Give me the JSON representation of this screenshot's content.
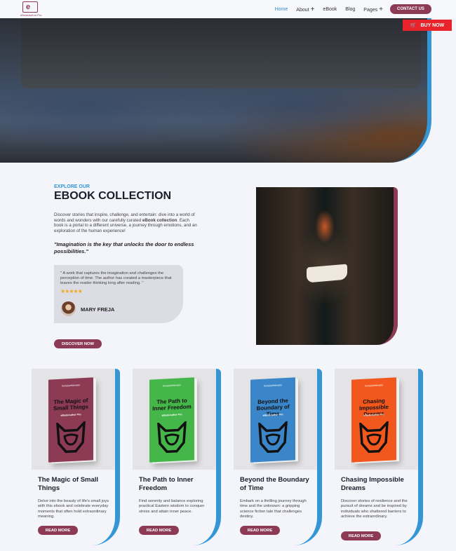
{
  "header": {
    "logo_text": "eBookAuthor Pro",
    "nav": [
      {
        "label": "Home",
        "active": true
      },
      {
        "label": "About",
        "has_submenu": true
      },
      {
        "label": "eBook"
      },
      {
        "label": "Blog"
      },
      {
        "label": "Pages",
        "has_submenu": true
      }
    ],
    "contact_label": "CONTACT US",
    "buy_label": "BUY NOW",
    "buy_icon": "cart-icon"
  },
  "collection": {
    "eyebrow": "EXPLORE OUR",
    "title": "EBOOK COLLECTION",
    "intro_before": "Discover stories that inspire, challenge, and entertain: dive into a world of words and wonders with our carefully curated ",
    "intro_bold": "eBook collection",
    "intro_after": ". Each book is a portal to a different universe, a journey through emotions, and an exploration of the human experience!",
    "quote": "\"Imagination is the key that unlocks the door to endless possibilities.\"",
    "testimonial": {
      "text": "\" A work that captures the imagination and challenges the perception of time. The author has created a masterpiece that leaves the reader thinking long after reading. \"",
      "rating": 5,
      "stars": "★★★★★",
      "name": "MARY FREJA"
    },
    "cta": "DISCOVER NOW"
  },
  "books": [
    {
      "cover_title": "The Magic of Small Things",
      "cover_sub": "eBookAuthor Pro",
      "cover_label": "TemplateMonster",
      "color": "#8d3a55",
      "title": "The Magic of Small Things",
      "desc": "Delve into the beauty of life's small joys with this ebook and celebrate everyday moments that often hold extraordinary meaning.",
      "button": "READ MORE"
    },
    {
      "cover_title": "The Path to Inner Freedom",
      "cover_sub": "eBookAuthor Pro",
      "cover_label": "TemplateMonster",
      "color": "#45b649",
      "title": "The Path to Inner Freedom",
      "desc": "Find serenity and balance exploring practical Eastern wisdom to conquer stress and attain inner peace.",
      "button": "READ MORE"
    },
    {
      "cover_title": "Beyond the Boundary of Time",
      "cover_sub": "eBookAuthor Pro",
      "cover_label": "TemplateMonster",
      "color": "#3a86c8",
      "title": "Beyond the Boundary of Time",
      "desc": "Embark on a thrilling journey through time and the unknown: a gripping science fiction tale that challenges destiny.",
      "button": "READ MORE"
    },
    {
      "cover_title": "Chasing Impossible Dreams",
      "cover_sub": "eBookAuthor Pro",
      "cover_label": "TemplateMonster",
      "color": "#f2581d",
      "title": "Chasing Impossible Dreams",
      "desc": "Discover stories of resilience and the pursuit of dreams and be inspired by individuals who shattered barriers to achieve the extraordinary.",
      "button": "READ MORE"
    }
  ],
  "colors": {
    "accent_blue": "#3496d4",
    "brand_maroon": "#8d3a55",
    "buy_red": "#e8242a"
  }
}
